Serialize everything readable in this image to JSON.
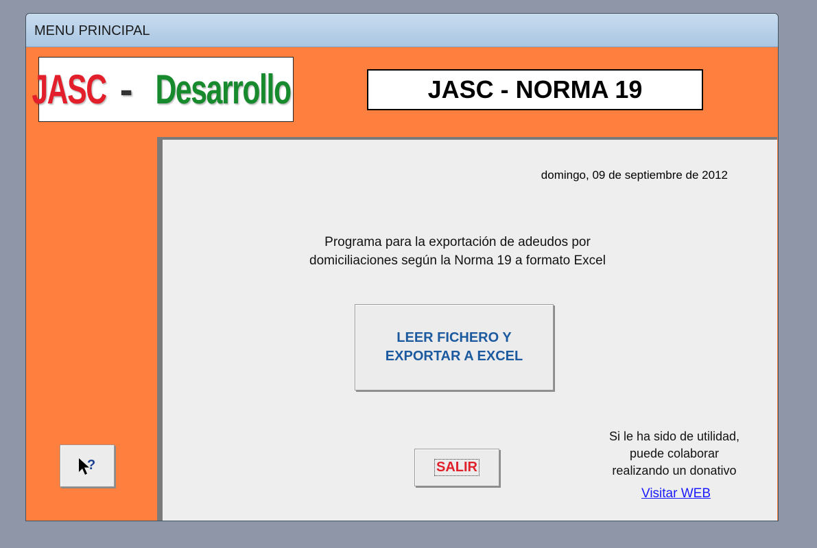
{
  "window": {
    "title": "MENU PRINCIPAL"
  },
  "header": {
    "logo_part1": "JASC",
    "logo_separator": "-",
    "logo_part2": "Desarrollo",
    "app_title": "JASC - NORMA 19"
  },
  "main": {
    "date": "domingo, 09 de septiembre de 2012",
    "description_line1": "Programa para la exportación de adeudos por",
    "description_line2": "domiciliaciones según la Norma 19 a formato Excel",
    "export_button_line1": "LEER FICHERO Y",
    "export_button_line2": "EXPORTAR A EXCEL",
    "exit_button_label": "SALIR",
    "donate_line1": "Si le ha sido de utilidad,",
    "donate_line2": "puede colaborar",
    "donate_line3": "realizando un donativo",
    "web_link": "Visitar WEB"
  },
  "sidebar": {
    "help_icon": "context-help-icon"
  },
  "colors": {
    "background": "#8f96a8",
    "accent_orange": "#ff7f3f",
    "panel": "#eeeeee",
    "logo_red": "#e21f2a",
    "logo_green": "#178a2d",
    "button_text_blue": "#1c5aa0",
    "exit_red": "#e0202a",
    "link_blue": "#1a1aff"
  }
}
